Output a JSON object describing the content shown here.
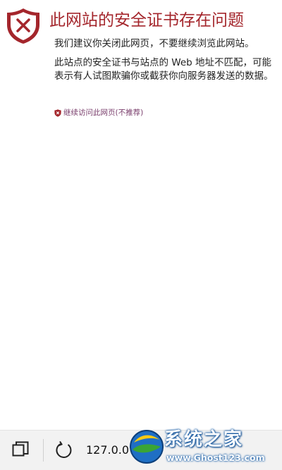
{
  "warning": {
    "title": "此网站的安全证书存在问题",
    "recommendation": "我们建议你关闭此网页，不要继续浏览此网站。",
    "detail": "此站点的安全证书与站点的 Web 地址不匹配，可能表示有人试图欺骗你或截获你向服务器发送的数据。",
    "continue_link": "继续访问此网页(不推荐)",
    "accent_color": "#a4262c",
    "icon": "shield-error-icon"
  },
  "bottom_bar": {
    "address": "127.0.0",
    "tabs_icon": "tabs-icon",
    "refresh_icon": "refresh-icon"
  },
  "watermark": {
    "brand": "系统之家",
    "site": "www.Ghost123.com"
  }
}
